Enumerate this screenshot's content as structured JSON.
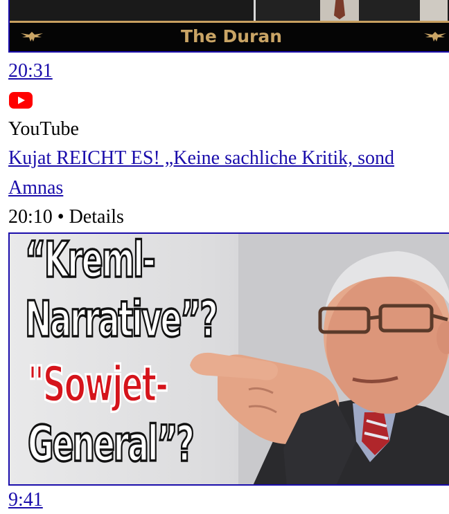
{
  "results": [
    {
      "thumbnail": {
        "banner_text": "The Duran"
      },
      "duration": "20:31"
    },
    {
      "source_icon": "youtube-icon",
      "source": "YouTube",
      "title": "Kujat REICHT ES! „Keine sachliche Kritik, sond",
      "channel": "Amnas",
      "meta": "20:10 • Details",
      "thumbnail": {
        "headline_line1": "“Kreml-",
        "headline_line2": "Narrative”?",
        "headline_line3": "\"Sowjet-",
        "headline_line4": "General”?"
      },
      "duration": "9:41"
    }
  ],
  "colors": {
    "link": "#1a0dab",
    "youtube_red": "#ff0000",
    "banner_gold": "#c9a465",
    "headline_red": "#d5141b"
  }
}
